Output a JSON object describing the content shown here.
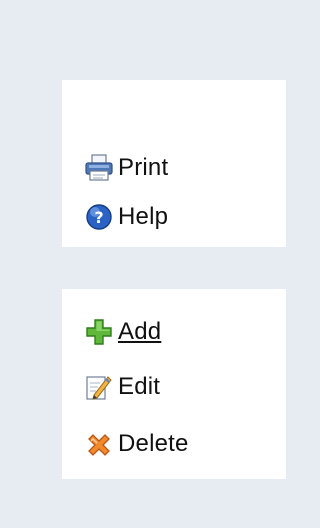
{
  "top_menu": {
    "items": [
      {
        "label": "Print",
        "icon": "printer-icon"
      },
      {
        "label": "Help",
        "icon": "help-icon"
      }
    ]
  },
  "bottom_menu": {
    "items": [
      {
        "label": "Add",
        "icon": "plus-icon"
      },
      {
        "label": "Edit",
        "icon": "edit-icon"
      },
      {
        "label": "Delete",
        "icon": "delete-icon"
      }
    ]
  },
  "colors": {
    "background": "#e7ebf2",
    "panel": "#ffffff",
    "text": "#111111",
    "add_green": "#5fb83a",
    "delete_orange": "#f08a2a",
    "help_blue": "#2a63c4"
  }
}
